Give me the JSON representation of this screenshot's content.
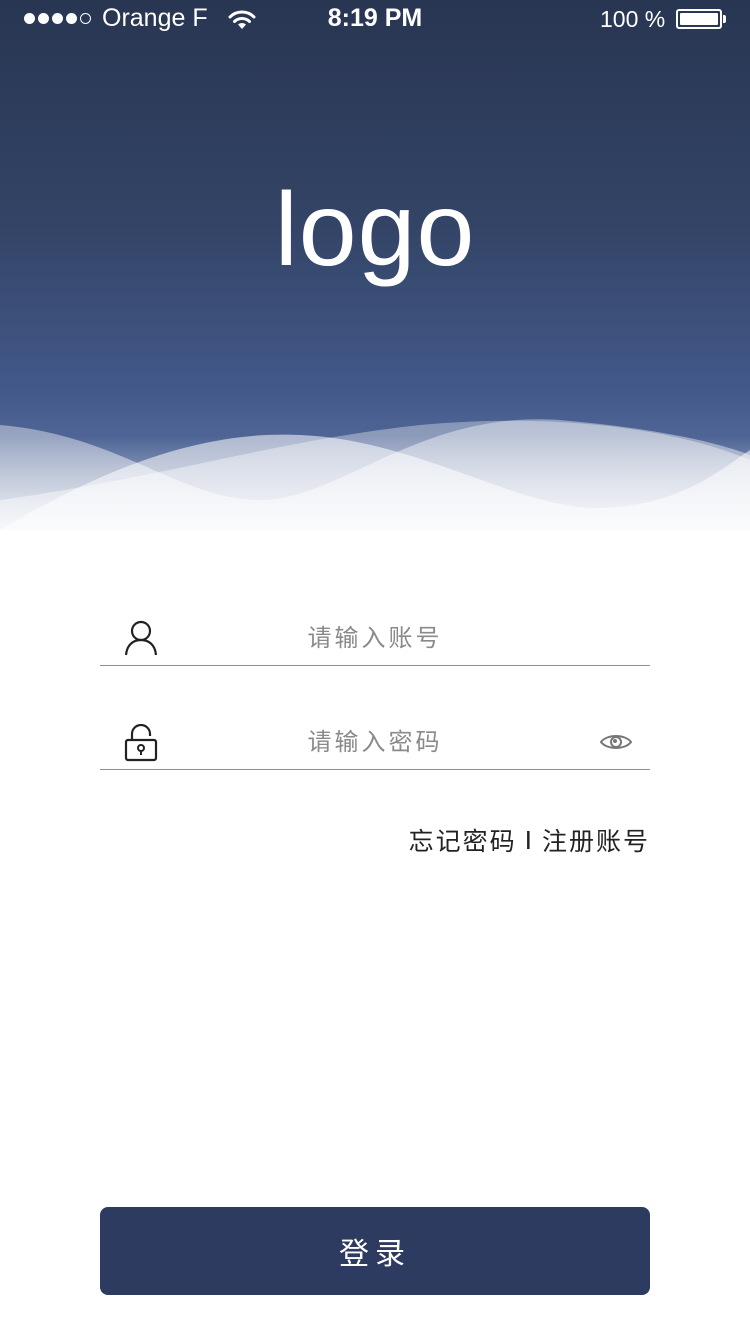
{
  "status_bar": {
    "carrier": "Orange F",
    "time": "8:19 PM",
    "battery": "100 %",
    "signal_bars_filled": 4,
    "signal_bars_total": 5
  },
  "logo": {
    "text": "logo"
  },
  "form": {
    "account_placeholder": "请输入账号",
    "password_placeholder": "请输入密码",
    "account_icon": "user-icon",
    "password_icon": "lock-icon",
    "visibility_icon": "eye-icon"
  },
  "links": {
    "forgot_password": "忘记密码",
    "separator": "I",
    "register": "注册账号"
  },
  "login_button": {
    "label": "登录"
  },
  "colors": {
    "header_dark": "#283652",
    "header_light": "#4f6596",
    "button": "#2c3b5f",
    "placeholder": "#8a8a8a"
  }
}
